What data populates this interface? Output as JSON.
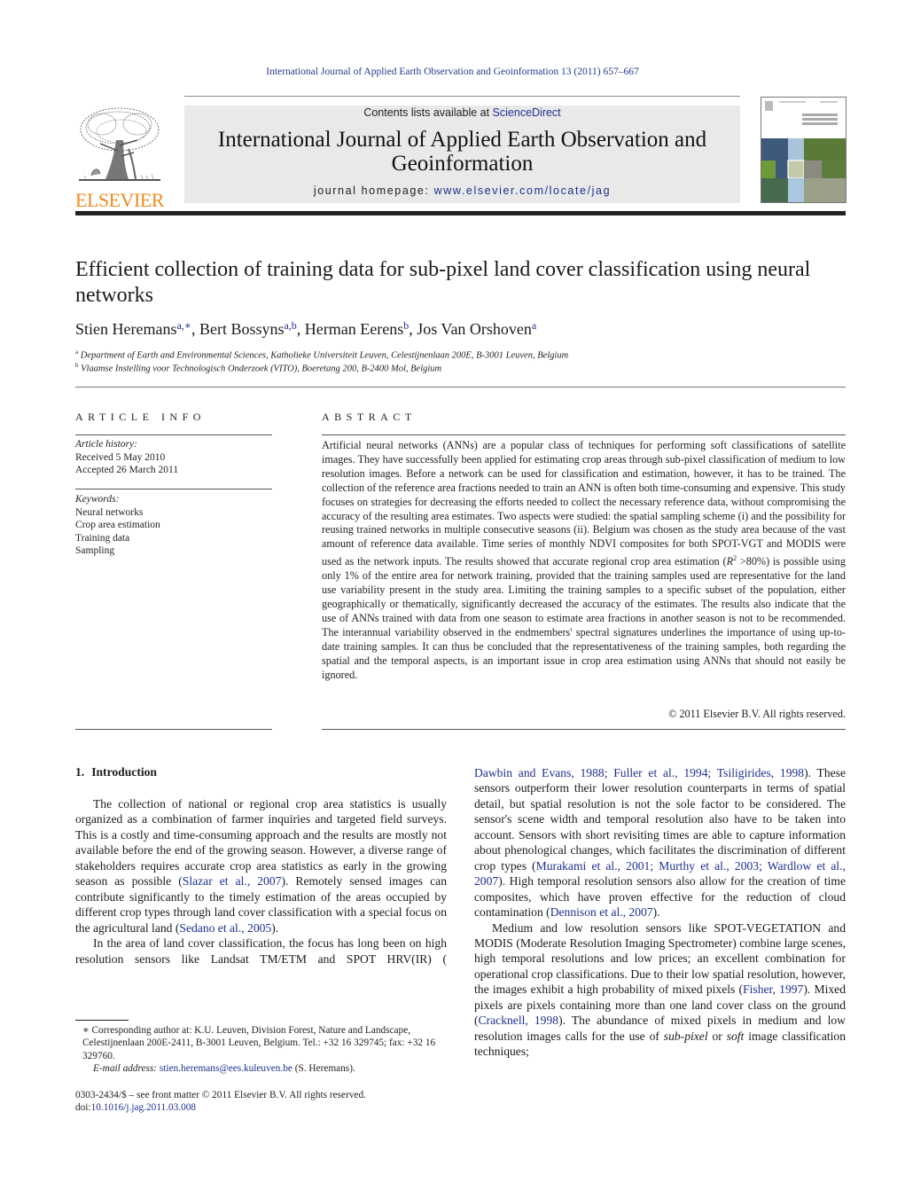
{
  "running_header": "International Journal of Applied Earth Observation and Geoinformation 13 (2011) 657–667",
  "masthead": {
    "publisher_logo_text": "ELSEVIER",
    "contents_prefix": "Contents lists available at ",
    "contents_link": "ScienceDirect",
    "journal_title_line1": "International Journal of Applied Earth Observation and",
    "journal_title_line2": "Geoinformation",
    "homepage_prefix": "journal homepage: ",
    "homepage_link": "www.elsevier.com/locate/jag",
    "cover_title": "APPLIED EARTH OBSERVATION AND GEOINFORMATION",
    "brand_orange": "#f08a1e",
    "link_blue": "#1f2f8f"
  },
  "article": {
    "title": "Efficient collection of training data for sub-pixel land cover classification using neural networks",
    "authors": [
      {
        "name": "Stien Heremans",
        "sup": "a,∗"
      },
      {
        "name": "Bert Bossyns",
        "sup": "a,b"
      },
      {
        "name": "Herman Eerens",
        "sup": "b"
      },
      {
        "name": "Jos Van Orshoven",
        "sup": "a"
      }
    ],
    "affiliations": [
      {
        "mark": "a",
        "text": "Department of Earth and Environmental Sciences, Katholieke Universiteit Leuven, Celestijnenlaan 200E, B-3001 Leuven, Belgium"
      },
      {
        "mark": "b",
        "text": "Vlaamse Instelling voor Technologisch Onderzoek (VITO), Boeretang 200, B-2400 Mol, Belgium"
      }
    ]
  },
  "article_info": {
    "heading": "ARTICLE INFO",
    "history_label": "Article history:",
    "received": "Received 5 May 2010",
    "accepted": "Accepted 26 March 2011",
    "keywords_label": "Keywords:",
    "keywords": [
      "Neural networks",
      "Crop area estimation",
      "Training data",
      "Sampling"
    ]
  },
  "abstract": {
    "heading": "ABSTRACT",
    "text_part1": "Artificial neural networks (ANNs) are a popular class of techniques for performing soft classifications of satellite images. They have successfully been applied for estimating crop areas through sub-pixel classification of medium to low resolution images. Before a network can be used for classification and estimation, however, it has to be trained. The collection of the reference area fractions needed to train an ANN is often both time-consuming and expensive. This study focuses on strategies for decreasing the efforts needed to collect the necessary reference data, without compromising the accuracy of the resulting area estimates. Two aspects were studied: the spatial sampling scheme (i) and the possibility for reusing trained networks in multiple consecutive seasons (ii). Belgium was chosen as the study area because of the vast amount of reference data available. Time series of monthly NDVI composites for both SPOT-VGT and MODIS were used as the network inputs. The results showed that accurate regional crop area estimation (",
    "r_symbol": "R",
    "r_exp": "2",
    "text_part2": " >80%) is possible using only 1% of the entire area for network training, provided that the training samples used are representative for the land use variability present in the study area. Limiting the training samples to a specific subset of the population, either geographically or thematically, significantly decreased the accuracy of the estimates. The results also indicate that the use of ANNs trained with data from one season to estimate area fractions in another season is not to be recommended. The interannual variability observed in the endmembers' spectral signatures underlines the importance of using up-to-date training samples. It can thus be concluded that the representativeness of the training samples, both regarding the spatial and the temporal aspects, is an important issue in crop area estimation using ANNs that should not easily be ignored.",
    "copyright": "© 2011 Elsevier B.V. All rights reserved."
  },
  "introduction": {
    "number": "1.",
    "heading": "Introduction",
    "p1": {
      "t1": "The collection of national or regional crop area statistics is usually organized as a combination of farmer inquiries and targeted field surveys. This is a costly and time-consuming approach and the results are mostly not available before the end of the growing season. However, a diverse range of stakeholders requires accurate crop area statistics as early in the growing season as possible (",
      "c1": "Slazar et al., 2007",
      "t2": "). Remotely sensed images can contribute significantly to the timely estimation of the areas occupied by different crop types through land cover classification with a special focus on the agricultural land (",
      "c2": "Sedano et al., 2005",
      "t3": ")."
    },
    "p2": {
      "t1": "In the area of land cover classification, the focus has long been on high resolution sensors like Landsat TM/ETM and SPOT HRV(IR) (",
      "c1": "Dawbin and Evans, 1988; Fuller et al., 1994; Tsiligirides, 1998",
      "t2": "). These sensors outperform their lower resolution counterparts in terms of spatial detail, but spatial resolution is not the sole factor to be considered. The sensor's scene width and temporal resolution also have to be taken into account. Sensors with short revisiting times are able to capture information about phenological changes, which facilitates the discrimination of different crop types (",
      "c2": "Murakami et al., 2001; Murthy et al., 2003; Wardlow et al., 2007",
      "t3": "). High temporal resolution sensors also allow for the creation of time composites, which have proven effective for the reduction of cloud contamination (",
      "c3": "Dennison et al., 2007",
      "t4": ")."
    },
    "p3": {
      "t1": "Medium and low resolution sensors like SPOT-VEGETATION and MODIS (Moderate Resolution Imaging Spectrometer) combine large scenes, high temporal resolutions and low prices; an excellent combination for operational crop classifications. Due to their low spatial resolution, however, the images exhibit a high probability of mixed pixels (",
      "c1": "Fisher, 1997",
      "t2": "). Mixed pixels are pixels containing more than one land cover class on the ground (",
      "c2": "Cracknell, 1998",
      "t3": "). The abundance of mixed pixels in medium and low resolution images calls for the use of ",
      "em1": "sub-pixel",
      "t4": " or ",
      "em2": "soft",
      "t5": " image classification techniques;"
    }
  },
  "footnote": {
    "star": "∗",
    "text": "Corresponding author at: K.U. Leuven, Division Forest, Nature and Landscape, Celestijnenlaan 200E-2411, B-3001 Leuven, Belgium. Tel.: +32 16 329745; fax: +32 16 329760.",
    "email_label": "E-mail address: ",
    "email": "stien.heremans@ees.kuleuven.be",
    "email_suffix": " (S. Heremans)."
  },
  "front_matter": {
    "issn_line": "0303-2434/$ – see front matter © 2011 Elsevier B.V. All rights reserved.",
    "doi_prefix": "doi:",
    "doi": "10.1016/j.jag.2011.03.008"
  }
}
